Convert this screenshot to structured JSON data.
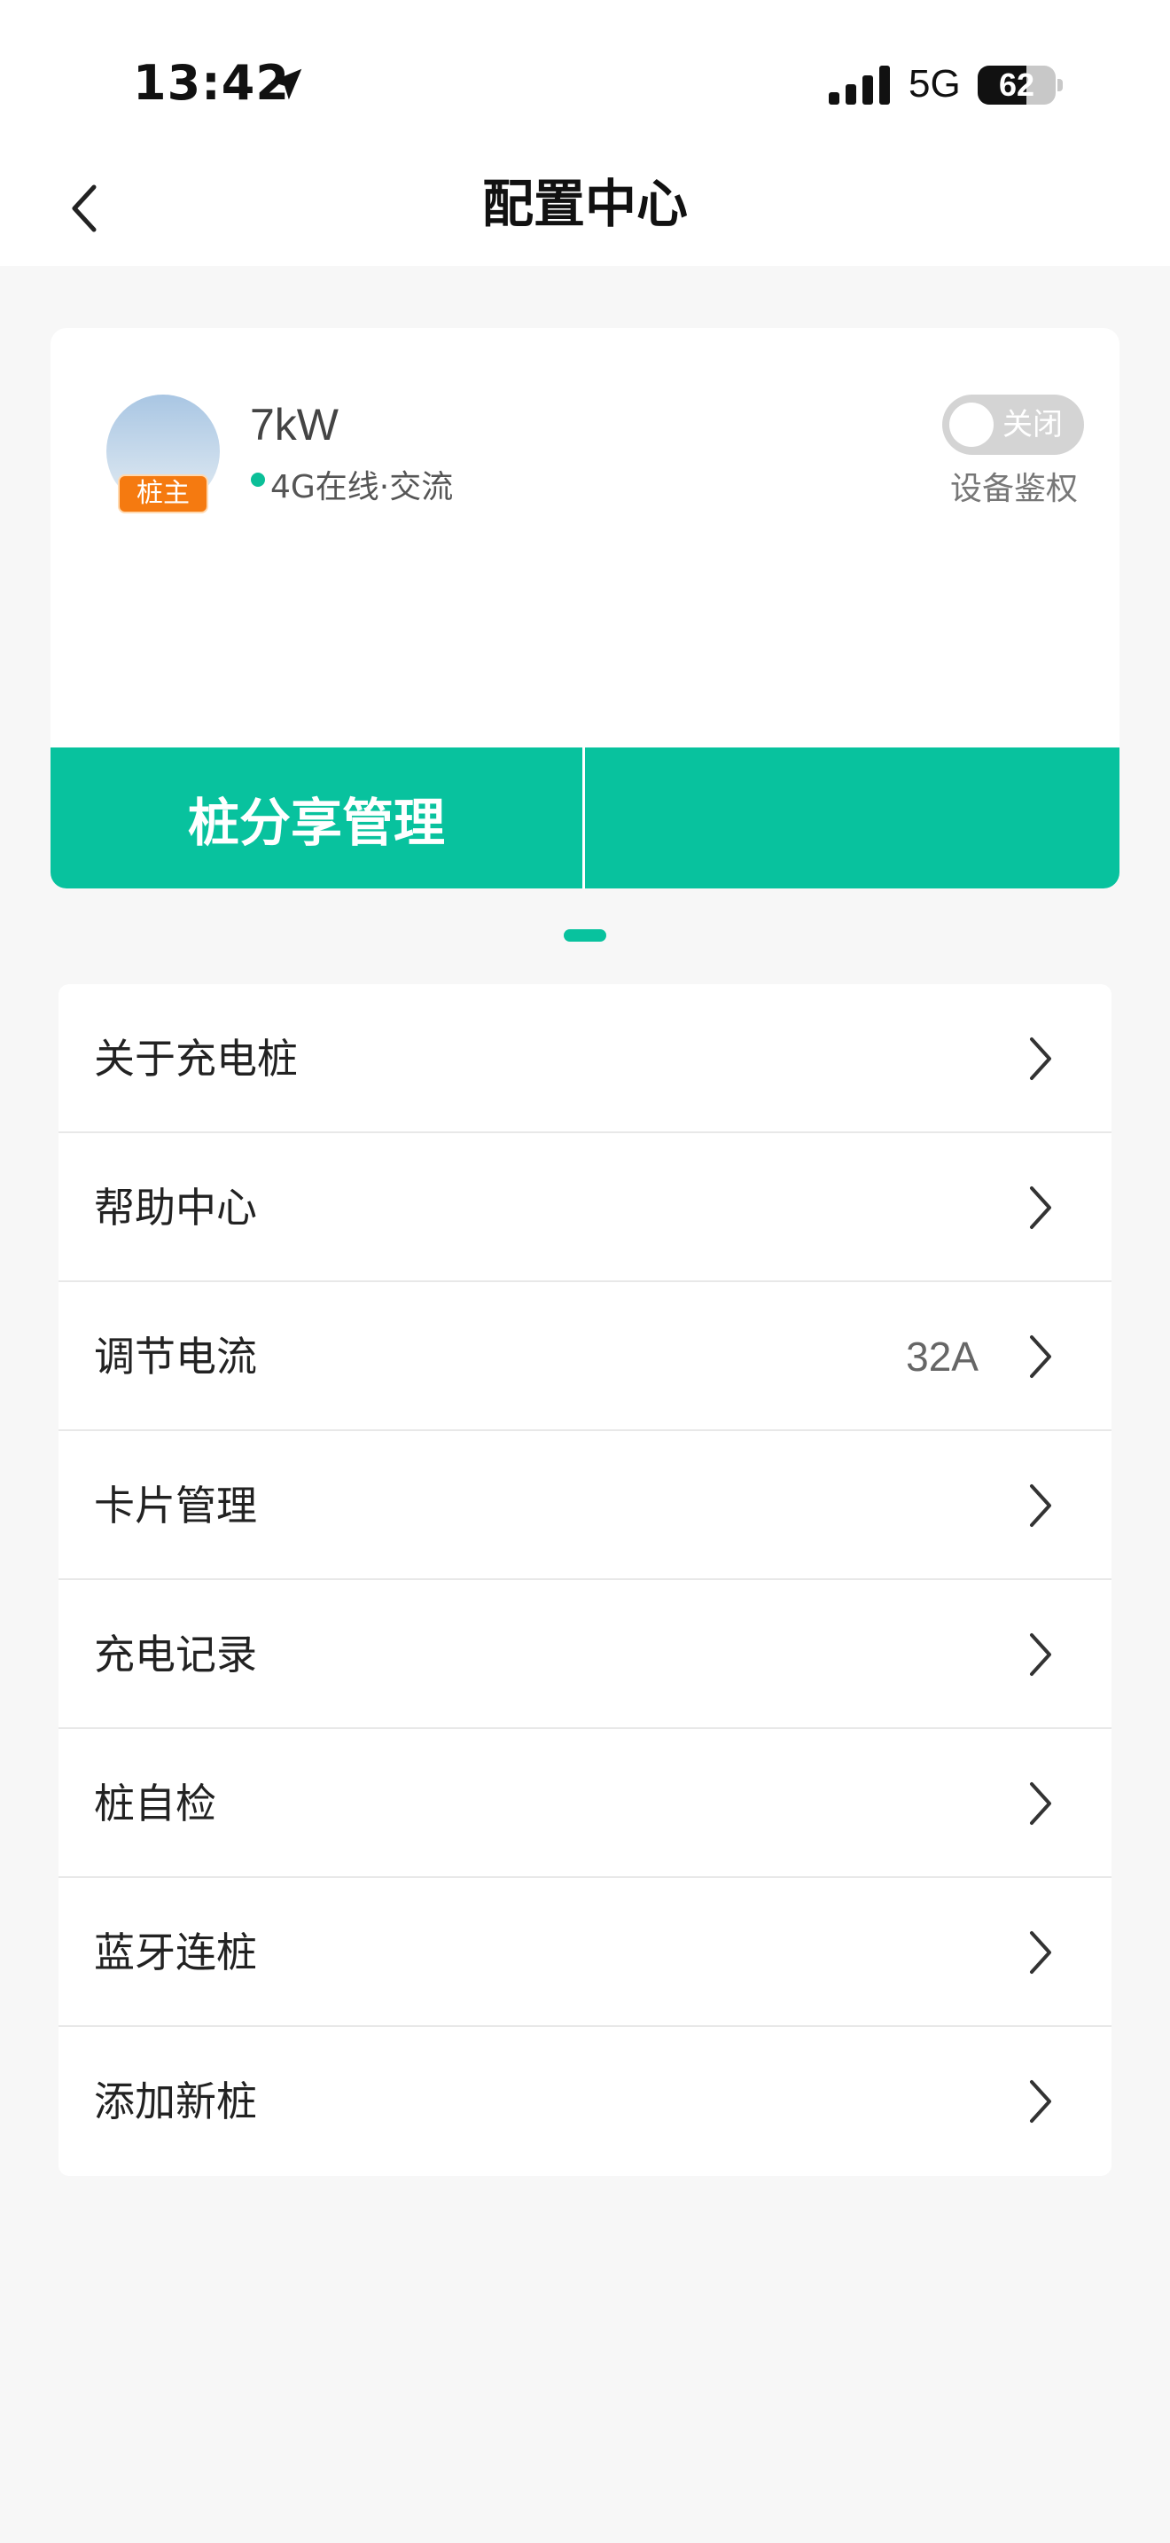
{
  "status_bar": {
    "time": "13:42",
    "location_icon": "location-arrow-icon",
    "signal_icon": "cellular-signal-icon",
    "network": "5G",
    "battery": "62"
  },
  "nav": {
    "back_icon": "chevron-left-icon",
    "title": "配置中心"
  },
  "device": {
    "avatar": "avatar",
    "badge": "桩主",
    "name": "7kW",
    "status": "4G在线·交流",
    "status_dot_color": "#0bbf98",
    "auth_toggle_label": "关闭",
    "auth_toggle_on": false,
    "auth_label": "设备鉴权"
  },
  "share": {
    "button_label": "桩分享管理"
  },
  "pager": {
    "pages": 1,
    "current": 1
  },
  "menu": {
    "items": [
      {
        "label": "关于充电桩",
        "value": ""
      },
      {
        "label": "帮助中心",
        "value": ""
      },
      {
        "label": "调节电流",
        "value": "32A"
      },
      {
        "label": "卡片管理",
        "value": ""
      },
      {
        "label": "充电记录",
        "value": ""
      },
      {
        "label": "桩自检",
        "value": ""
      },
      {
        "label": "蓝牙连桩",
        "value": ""
      },
      {
        "label": "添加新桩",
        "value": ""
      }
    ]
  },
  "colors": {
    "accent": "#08c29e",
    "badge": "#f57a10",
    "background": "#f7f7f7"
  }
}
